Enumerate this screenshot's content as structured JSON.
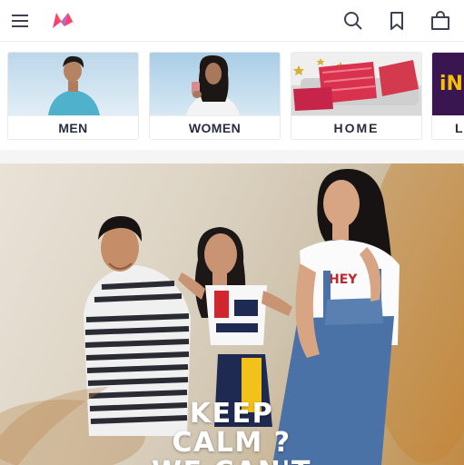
{
  "header": {
    "menu_icon": "hamburger-menu-icon",
    "logo_icon": "myntra-logo-icon",
    "search_icon": "search-icon",
    "wishlist_icon": "bookmark-icon",
    "bag_icon": "shopping-bag-icon",
    "brand_colors": [
      "#ff3f6c",
      "#f26a10",
      "#a74fbf"
    ]
  },
  "categories": [
    {
      "label": "MEN"
    },
    {
      "label": "WOMEN"
    },
    {
      "label": "HOME"
    },
    {
      "label": "L",
      "badge": "iN"
    }
  ],
  "hero": {
    "line1": "KEEP",
    "line2": "CALM ?",
    "line3": "WE CAN'T"
  }
}
